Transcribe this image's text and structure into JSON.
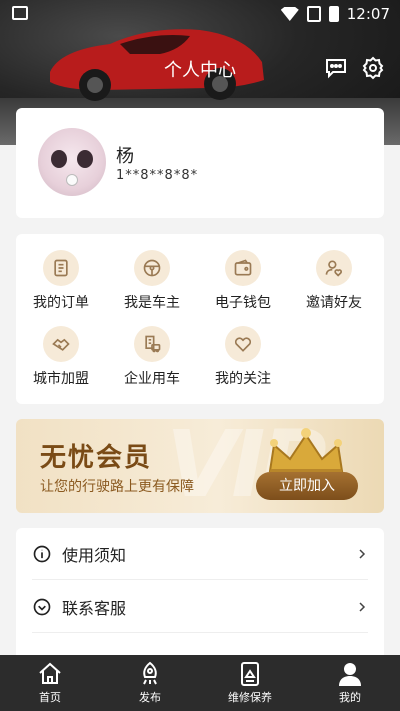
{
  "status_bar": {
    "time": "12:07"
  },
  "header": {
    "title": "个人中心"
  },
  "profile": {
    "name": "杨",
    "phone": "1**8**8*8*"
  },
  "grid": {
    "items": [
      {
        "label": "我的订单",
        "icon": "order-icon"
      },
      {
        "label": "我是车主",
        "icon": "steering-wheel-icon"
      },
      {
        "label": "电子钱包",
        "icon": "wallet-icon"
      },
      {
        "label": "邀请好友",
        "icon": "invite-friend-icon"
      },
      {
        "label": "城市加盟",
        "icon": "handshake-icon"
      },
      {
        "label": "企业用车",
        "icon": "enterprise-car-icon"
      },
      {
        "label": "我的关注",
        "icon": "heart-icon"
      }
    ]
  },
  "vip": {
    "title": "无忧会员",
    "subtitle": "让您的行驶路上更有保障",
    "button": "立即加入"
  },
  "list": {
    "items": [
      {
        "label": "使用须知",
        "icon": "info-icon"
      },
      {
        "label": "联系客服",
        "icon": "customer-service-icon"
      }
    ]
  },
  "bottom_nav": {
    "items": [
      {
        "label": "首页",
        "icon": "home-icon"
      },
      {
        "label": "发布",
        "icon": "publish-icon"
      },
      {
        "label": "维修保养",
        "icon": "maintenance-icon"
      },
      {
        "label": "我的",
        "icon": "person-icon",
        "active": true
      }
    ]
  },
  "colors": {
    "accent": "#7d4e1b",
    "nav_bg": "#2c2c2c",
    "icon_bg": "#f6ead8"
  }
}
